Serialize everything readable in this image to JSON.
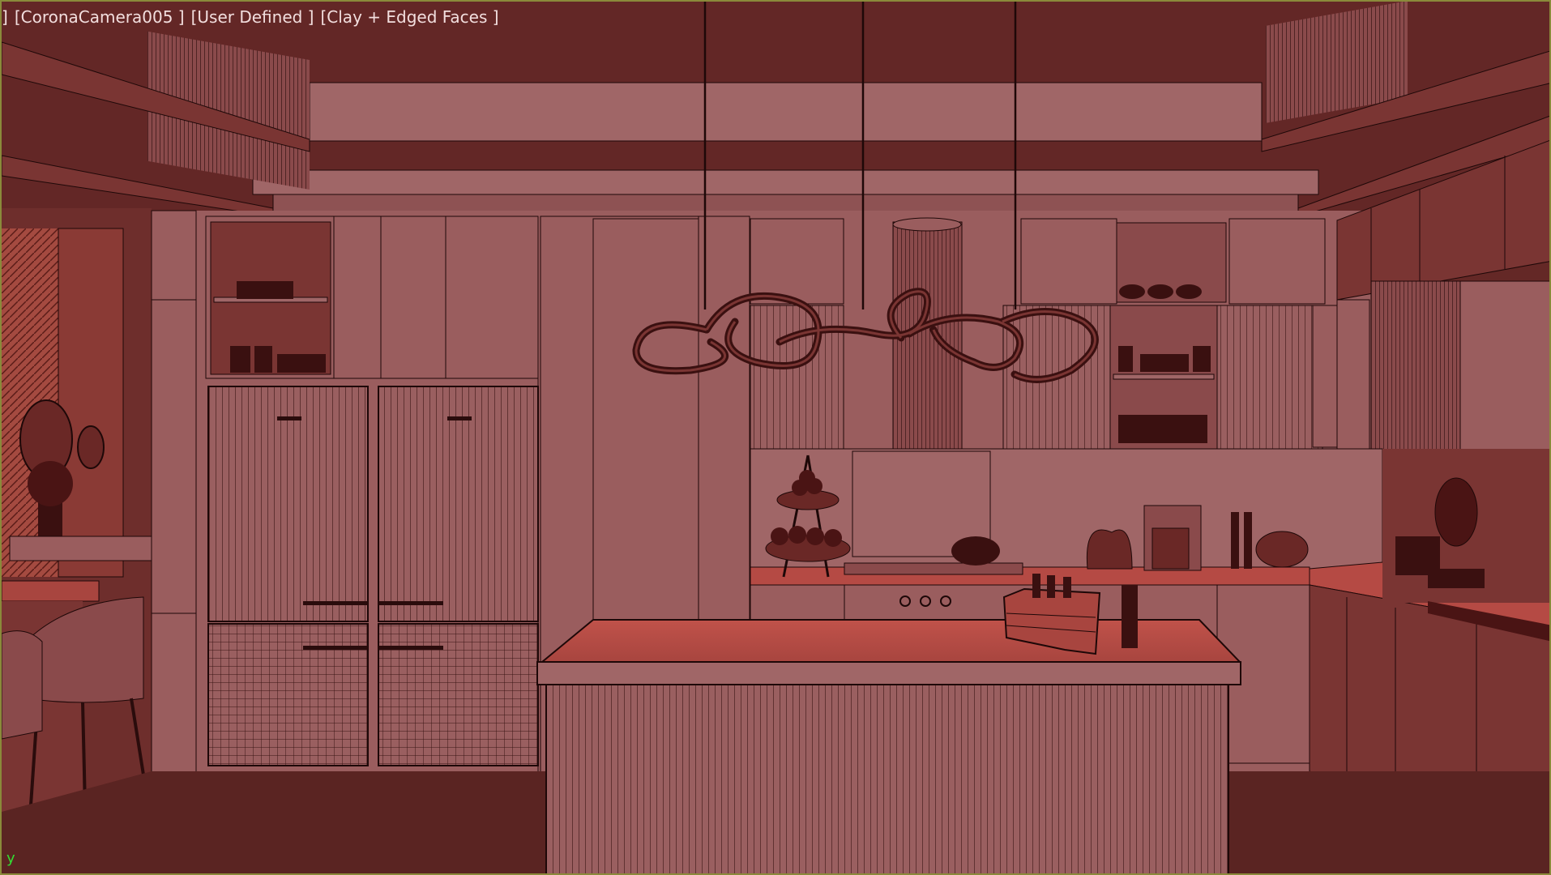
{
  "viewport": {
    "label_prefix": "]",
    "camera": "[CoronaCamera005 ]",
    "fov_mode": "[User Defined ]",
    "shading": "[Clay + Edged Faces ]",
    "axis": "y"
  },
  "colors": {
    "background": "#642826",
    "wall": "#9a5d5e",
    "ceiling_panel": "#a06667",
    "counter_top": "#b54a44",
    "edge_line": "#1e0808",
    "frame_border": "#8a8a3a",
    "axis_color": "#33dd33"
  }
}
